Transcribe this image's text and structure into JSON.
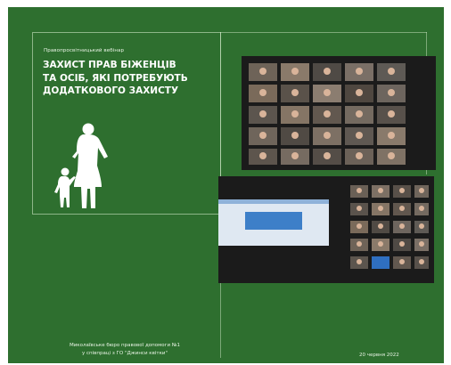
{
  "webinar": {
    "subtitle": "Правопросвітницький вебінар",
    "title_lines": [
      "ЗАХИСТ ПРАВ БІЖЕНЦІВ",
      "ТА ОСІБ, ЯКІ ПОТРЕБУЮТЬ",
      "ДОДАТКОВОГО ЗАХИСТУ"
    ]
  },
  "footer": {
    "organizer_line1": "Миколаївське бюро правової допомоги №1",
    "organizer_line2": "у співпраці з ГО \"Джинси квітки\"",
    "date": "20 червня 2022"
  },
  "colors": {
    "background": "#2e6f2f",
    "text": "#ffffff",
    "screen": "#1b1b1b"
  },
  "icons": {
    "family": "mother-and-child-silhouette-icon"
  }
}
